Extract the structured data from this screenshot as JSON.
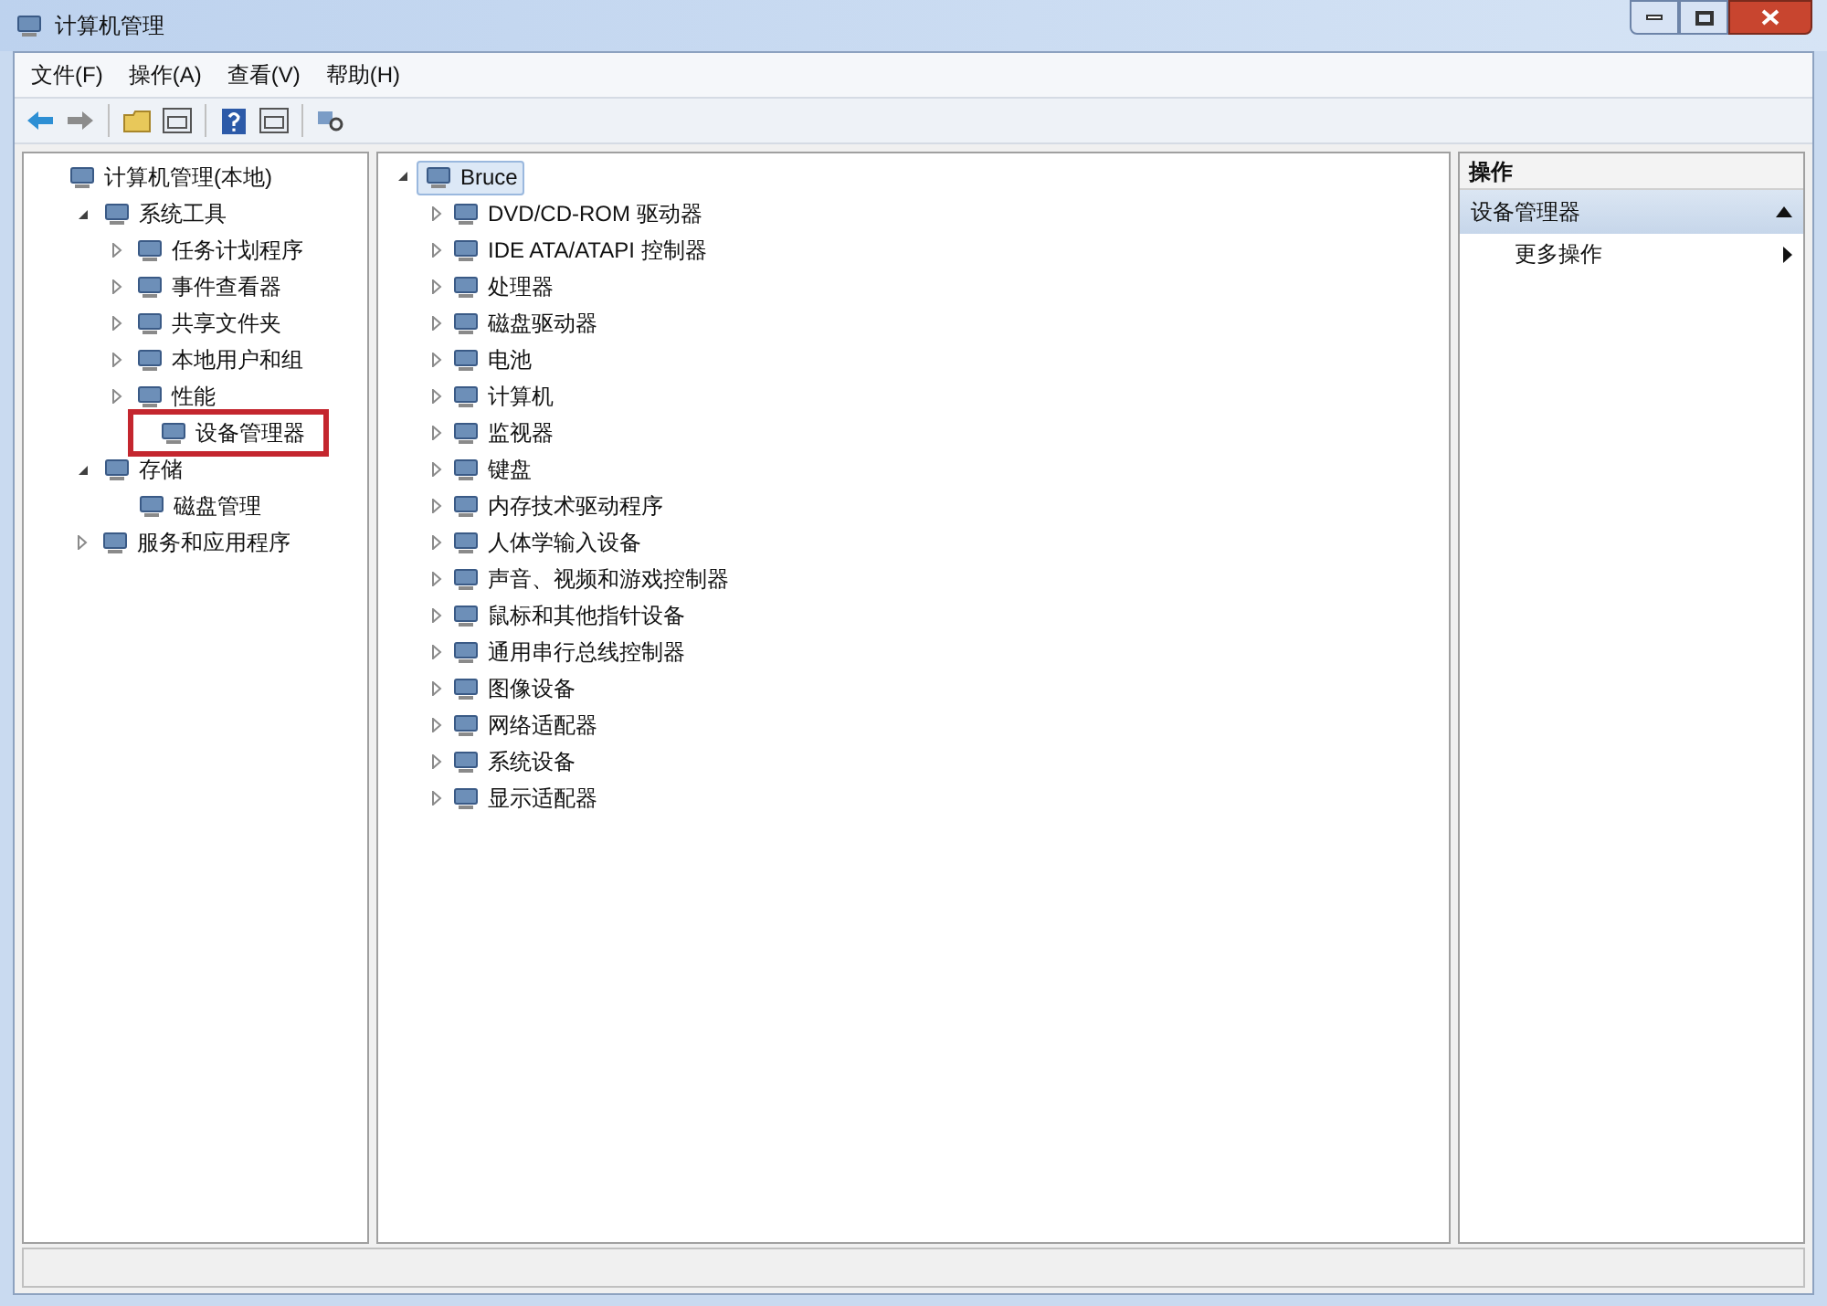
{
  "window": {
    "title": "计算机管理"
  },
  "menu": [
    "文件(F)",
    "操作(A)",
    "查看(V)",
    "帮助(H)"
  ],
  "nav_tree": [
    {
      "label": "计算机管理(本地)",
      "expandable": false,
      "expanded": true,
      "highlighted": false,
      "children": [
        {
          "label": "系统工具",
          "expandable": true,
          "expanded": true,
          "highlighted": false,
          "children": [
            {
              "label": "任务计划程序",
              "expandable": true,
              "expanded": false,
              "highlighted": false
            },
            {
              "label": "事件查看器",
              "expandable": true,
              "expanded": false,
              "highlighted": false
            },
            {
              "label": "共享文件夹",
              "expandable": true,
              "expanded": false,
              "highlighted": false
            },
            {
              "label": "本地用户和组",
              "expandable": true,
              "expanded": false,
              "highlighted": false
            },
            {
              "label": "性能",
              "expandable": true,
              "expanded": false,
              "highlighted": false
            },
            {
              "label": "设备管理器",
              "expandable": false,
              "expanded": false,
              "highlighted": true
            }
          ]
        },
        {
          "label": "存储",
          "expandable": true,
          "expanded": true,
          "highlighted": false,
          "children": [
            {
              "label": "磁盘管理",
              "expandable": false,
              "expanded": false,
              "highlighted": false
            }
          ]
        },
        {
          "label": "服务和应用程序",
          "expandable": true,
          "expanded": false,
          "highlighted": false
        }
      ]
    }
  ],
  "device_tree": {
    "root": "Bruce",
    "expanded": true,
    "selected": true,
    "categories": [
      {
        "label": "DVD/CD-ROM 驱动器",
        "expanded": false
      },
      {
        "label": "IDE ATA/ATAPI 控制器",
        "expanded": false
      },
      {
        "label": "处理器",
        "expanded": false
      },
      {
        "label": "磁盘驱动器",
        "expanded": false
      },
      {
        "label": "电池",
        "expanded": false
      },
      {
        "label": "计算机",
        "expanded": false
      },
      {
        "label": "监视器",
        "expanded": false
      },
      {
        "label": "键盘",
        "expanded": false
      },
      {
        "label": "内存技术驱动程序",
        "expanded": false
      },
      {
        "label": "人体学输入设备",
        "expanded": false
      },
      {
        "label": "声音、视频和游戏控制器",
        "expanded": false
      },
      {
        "label": "鼠标和其他指针设备",
        "expanded": false
      },
      {
        "label": "通用串行总线控制器",
        "expanded": false
      },
      {
        "label": "图像设备",
        "expanded": false
      },
      {
        "label": "网络适配器",
        "expanded": false
      },
      {
        "label": "系统设备",
        "expanded": false
      },
      {
        "label": "显示适配器",
        "expanded": false
      }
    ]
  },
  "actions": {
    "header": "操作",
    "section": {
      "title": "设备管理器",
      "expanded": true
    },
    "items": [
      {
        "label": "更多操作"
      }
    ]
  }
}
